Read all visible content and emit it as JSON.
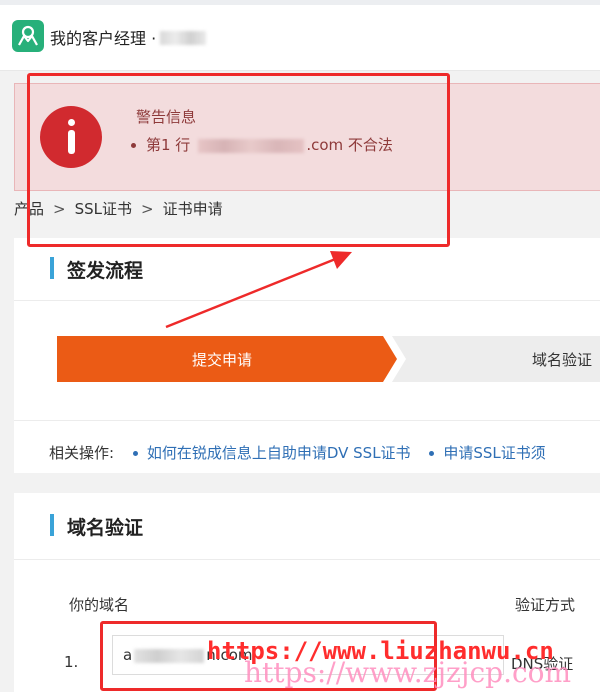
{
  "header": {
    "app_title": "我的客户经理",
    "title_dot": "·"
  },
  "warning": {
    "title": "警告信息",
    "line_prefix": "第1 行",
    "line_domain_suffix": ".com",
    "line_status": "不合法",
    "icon": "alert-circle-icon",
    "color": "#d12a2f"
  },
  "breadcrumb": {
    "items": [
      "产品",
      "SSL证书",
      "证书申请"
    ],
    "separator": ">"
  },
  "issuance": {
    "title": "签发流程",
    "steps": [
      "提交申请",
      "域名验证"
    ],
    "active_step_color": "#eb5b15",
    "related_label": "相关操作:",
    "links": [
      "如何在锐成信息上自助申请DV SSL证书",
      "申请SSL证书须"
    ]
  },
  "domain_verify": {
    "title": "域名验证",
    "col_domain": "你的域名",
    "col_method": "验证方式",
    "rows": [
      {
        "index": "1.",
        "domain_prefix": "a",
        "domain_suffix": "n.com",
        "method": "DNS验证"
      }
    ]
  },
  "watermarks": {
    "line1": "https://www.liuzhanwu.cn",
    "line2": "https://www.zjzjcp.com"
  },
  "colors": {
    "accent_blue": "#3aa3d8",
    "link_blue": "#2f6fb5",
    "annotation_red": "#ee2a2a",
    "brand_green": "#27b07a"
  }
}
